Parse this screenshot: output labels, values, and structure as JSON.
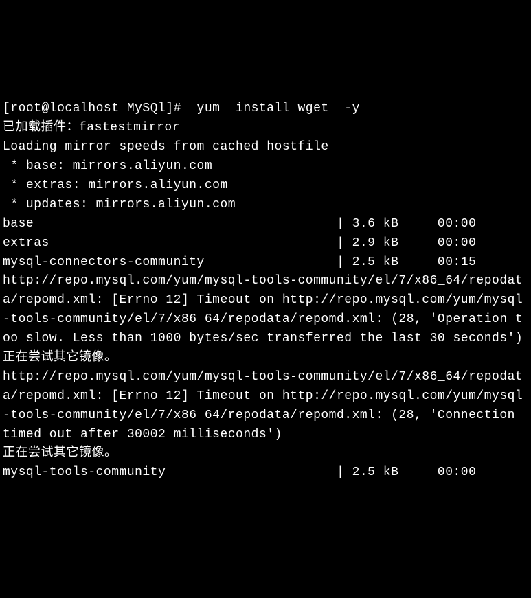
{
  "terminal": {
    "promptLine": "[root@localhost MySQl]#  yum  install wget  -y",
    "lines": [
      "已加载插件：fastestmirror",
      "Loading mirror speeds from cached hostfile",
      " * base: mirrors.aliyun.com",
      " * extras: mirrors.aliyun.com",
      " * updates: mirrors.aliyun.com",
      "base                                       | 3.6 kB     00:00",
      "extras                                     | 2.9 kB     00:00",
      "mysql-connectors-community                 | 2.5 kB     00:15",
      "http://repo.mysql.com/yum/mysql-tools-community/el/7/x86_64/repodata/repomd.xml: [Errno 12] Timeout on http://repo.mysql.com/yum/mysql-tools-community/el/7/x86_64/repodata/repomd.xml: (28, 'Operation too slow. Less than 1000 bytes/sec transferred the last 30 seconds')",
      "正在尝试其它镜像。",
      "http://repo.mysql.com/yum/mysql-tools-community/el/7/x86_64/repodata/repomd.xml: [Errno 12] Timeout on http://repo.mysql.com/yum/mysql-tools-community/el/7/x86_64/repodata/repomd.xml: (28, 'Connection timed out after 30002 milliseconds')",
      "正在尝试其它镜像。",
      "mysql-tools-community                      | 2.5 kB     00:00"
    ]
  }
}
